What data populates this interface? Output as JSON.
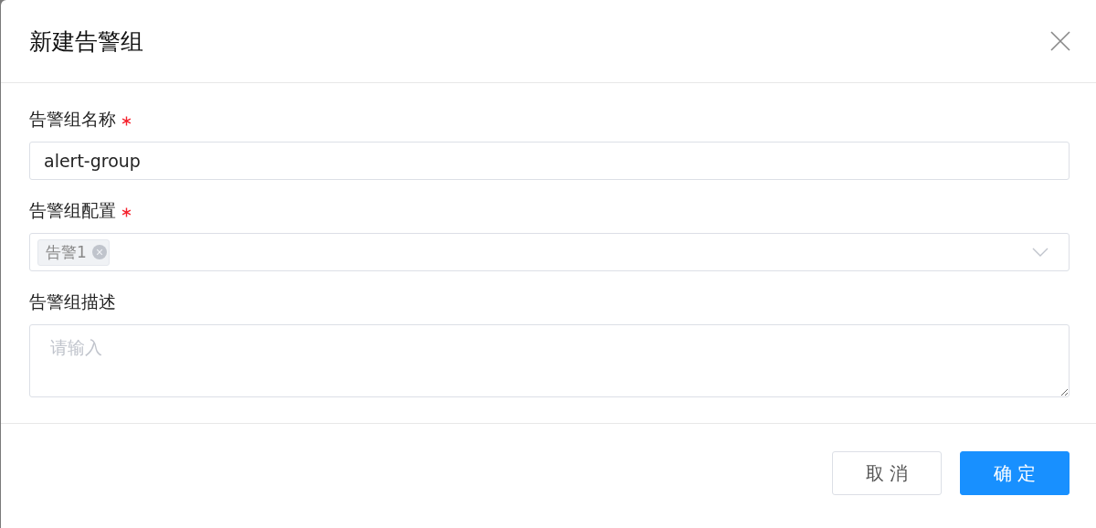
{
  "dialog": {
    "title": "新建告警组",
    "fields": [
      {
        "kind": "text",
        "label": "告警组名称",
        "required": true,
        "value": "alert-group"
      },
      {
        "kind": "multiselect",
        "label": "告警组配置",
        "required": true,
        "tags": [
          "告警1"
        ]
      },
      {
        "kind": "textarea",
        "label": "告警组描述",
        "required": false,
        "placeholder": "请输入"
      }
    ],
    "buttons": [
      {
        "label": "取消",
        "kind": "default"
      },
      {
        "label": "确定",
        "kind": "primary"
      }
    ]
  }
}
